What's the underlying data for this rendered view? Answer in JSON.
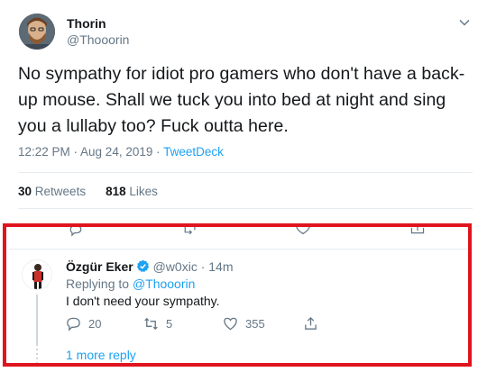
{
  "tweet": {
    "author_name": "Thorin",
    "author_handle": "@Thooorin",
    "text": "No sympathy for idiot pro gamers who don't have a back-up mouse.  Shall we tuck you into bed at night and sing you a lullaby too?  Fuck outta here.",
    "time": "12:22 PM · Aug 24, 2019 · ",
    "client": "TweetDeck",
    "retweets_count": "30",
    "retweets_label": "Retweets",
    "likes_count": "818",
    "likes_label": "Likes"
  },
  "reply": {
    "author_name": "Özgür Eker",
    "author_handle": "@w0xic",
    "time": "· 14m",
    "replying_prefix": "Replying to ",
    "replying_to": "@Thooorin",
    "text": "I don't need your sympathy.",
    "reply_count": "20",
    "retweet_count": "5",
    "like_count": "355"
  },
  "thread": {
    "more_replies": "1 more reply"
  },
  "colors": {
    "accent": "#1da1f2",
    "secondary_text": "#657786",
    "highlight": "#e0141e"
  },
  "icons": [
    "chevron-down-icon",
    "reply-icon",
    "retweet-icon",
    "heart-icon",
    "share-icon",
    "verified-badge-icon"
  ]
}
